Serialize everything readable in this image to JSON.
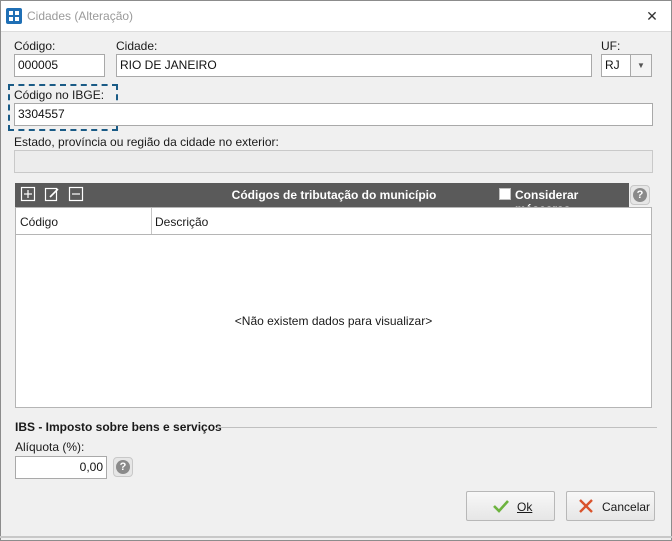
{
  "window": {
    "title": "Cidades (Alteração)",
    "close_glyph": "✕",
    "icon": "grid-app-icon"
  },
  "form": {
    "codigo": {
      "label": "Código:",
      "value": "000005"
    },
    "cidade": {
      "label": "Cidade:",
      "value": "RIO DE JANEIRO"
    },
    "uf": {
      "label": "UF:",
      "value": "RJ"
    },
    "codigo_ibge": {
      "label": "Código no IBGE:",
      "value": "3304557"
    },
    "estado_exterior": {
      "label": "Estado, província ou região da cidade no exterior:",
      "value": ""
    }
  },
  "tributacao": {
    "title": "Códigos de tributação do município",
    "considerar_mascaras": "Considerar máscaras",
    "columns": [
      "Código",
      "Descrição"
    ],
    "rows": [],
    "empty_message": "<Não existem dados para visualizar>",
    "toolbar_icons": [
      "add-icon",
      "edit-icon",
      "remove-icon"
    ]
  },
  "ibs": {
    "section_title": "IBS - Imposto sobre bens e serviços",
    "aliquota": {
      "label": "Alíquota (%):",
      "value": "0,00"
    }
  },
  "buttons": {
    "ok": "Ok",
    "cancelar": "Cancelar"
  },
  "help_glyph": "?",
  "colors": {
    "toolbar_bg": "#5a5a5a",
    "focus": "#1a5b86",
    "ok_check": "#6db33f",
    "cancel_x": "#d9532c"
  }
}
